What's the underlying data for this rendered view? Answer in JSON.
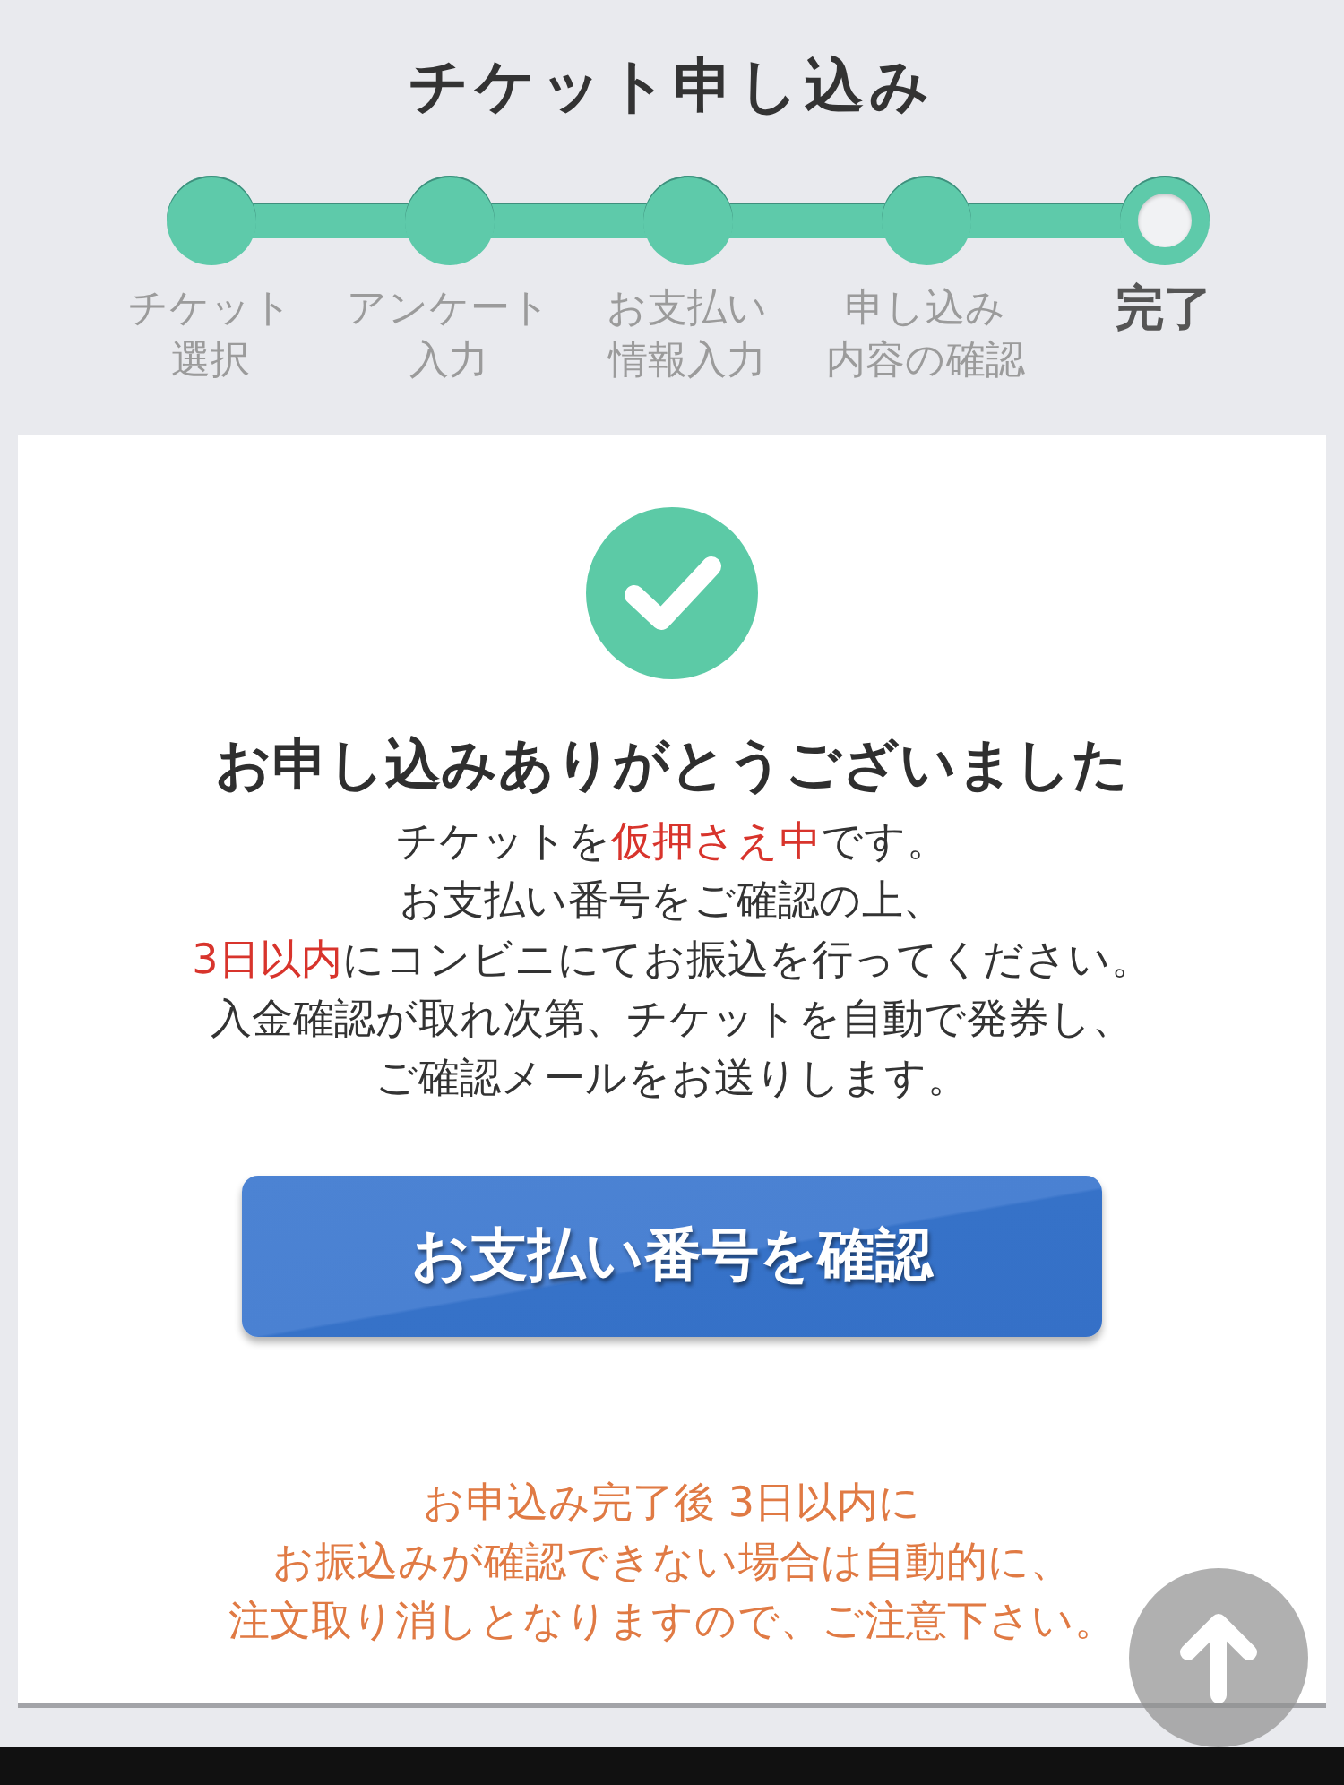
{
  "header": {
    "title": "チケット申し込み"
  },
  "steps": [
    {
      "label": [
        "チケット",
        "選択"
      ],
      "selected": false
    },
    {
      "label": [
        "アンケート",
        "入力"
      ],
      "selected": false
    },
    {
      "label": [
        "お支払い",
        "情報入力"
      ],
      "selected": false
    },
    {
      "label": [
        "申し込み",
        "内容の確認"
      ],
      "selected": false
    },
    {
      "label": [
        "完了"
      ],
      "selected": true
    }
  ],
  "confirmation": {
    "heading": "お申し込みありがとうございました",
    "message": [
      [
        {
          "text": "チケットを",
          "highlight": false
        },
        {
          "text": "仮押さえ中",
          "highlight": true
        },
        {
          "text": "です。",
          "highlight": false
        }
      ],
      [
        {
          "text": "お支払い番号をご確認の上、",
          "highlight": false
        }
      ],
      [
        {
          "text": "3日以内",
          "highlight": true
        },
        {
          "text": "にコンビニにてお振込を行ってください。",
          "highlight": false
        }
      ],
      [
        {
          "text": "入金確認が取れ次第、チケットを自動で発券し、",
          "highlight": false
        }
      ],
      [
        {
          "text": "ご確認メールをお送りします。",
          "highlight": false
        }
      ]
    ],
    "button": "お支払い番号を確認",
    "notice": [
      "お申込み完了後 3日以内に",
      "お振込みが確認できない場合は自動的に、",
      "注文取り消しとなりますので、ご注意下さい。"
    ]
  }
}
